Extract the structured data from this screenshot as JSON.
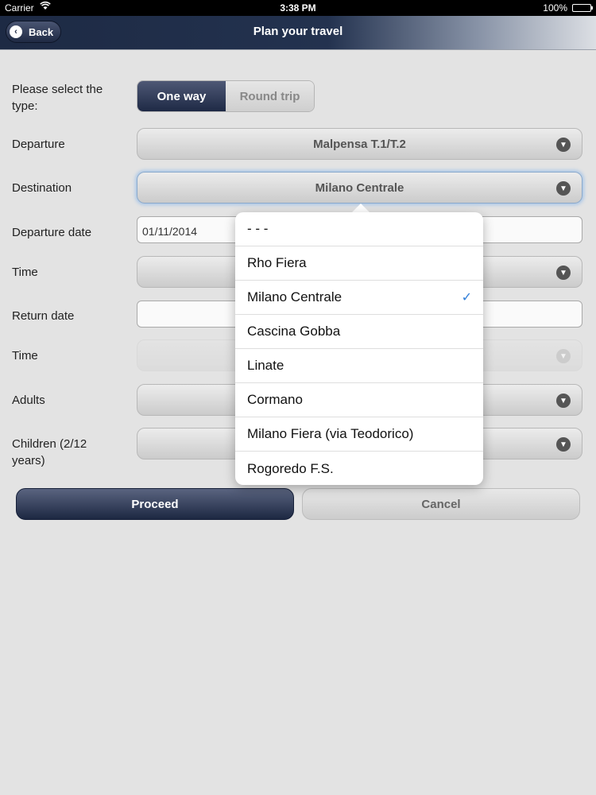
{
  "status_bar": {
    "carrier": "Carrier",
    "time": "3:38 PM",
    "battery": "100%"
  },
  "nav": {
    "back_label": "Back",
    "title": "Plan your travel"
  },
  "form": {
    "type_label": "Please select the type:",
    "type_options": [
      "One way",
      "Round trip"
    ],
    "type_selected": "One way",
    "departure_label": "Departure",
    "departure_value": "Malpensa T.1/T.2",
    "destination_label": "Destination",
    "destination_value": "Milano Centrale",
    "departure_date_label": "Departure date",
    "departure_date_value": "01/11/2014",
    "time_label": "Time",
    "return_date_label": "Return date",
    "return_time_label": "Time",
    "adults_label": "Adults",
    "children_label": "Children (2/12 years)"
  },
  "buttons": {
    "proceed": "Proceed",
    "cancel": "Cancel"
  },
  "dropdown": {
    "options": [
      "- - -",
      "Rho Fiera",
      "Milano Centrale",
      "Cascina Gobba",
      "Linate",
      "Cormano",
      "Milano Fiera (via Teodorico)",
      "Rogoredo F.S."
    ],
    "selected": "Milano Centrale"
  },
  "colors": {
    "nav_dark": "#1d2a44",
    "accent_check": "#2f7ed8"
  }
}
